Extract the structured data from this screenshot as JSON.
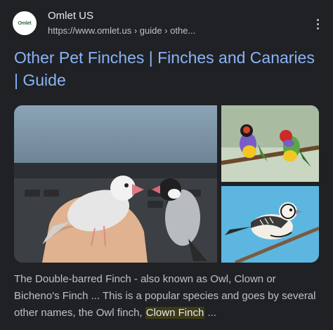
{
  "result": {
    "site_name": "Omlet US",
    "favicon_text": "Omlet",
    "url": "https://www.omlet.us › guide › othe...",
    "title": "Other Pet Finches | Finches and Canaries | Guide",
    "snippet_before": "The Double-barred Finch - also known as Owl, Clown or Bicheno's Finch ... This is a popular species and goes by several other names, the Owl finch, ",
    "snippet_highlight": "Clown Finch",
    "snippet_after": " ..."
  },
  "colors": {
    "background": "#202124",
    "link": "#8ab4f8",
    "text": "#bdc1c6",
    "highlight_bg": "#3d3a16"
  }
}
